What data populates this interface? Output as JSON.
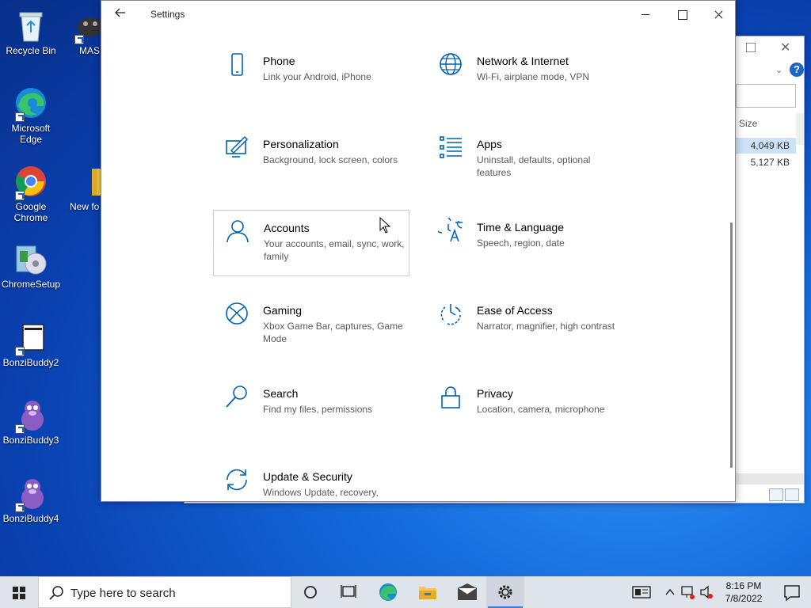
{
  "desktop": {
    "icons": [
      {
        "label": "Recycle Bin"
      },
      {
        "label": "MASM"
      },
      {
        "label": "Microsoft Edge"
      },
      {
        "label": "Google Chrome"
      },
      {
        "label": "New fo"
      },
      {
        "label": "ChromeSetup"
      },
      {
        "label": "BonziBuddy2"
      },
      {
        "label": "BonziBuddy3"
      },
      {
        "label": "BonziBuddy4"
      }
    ]
  },
  "explorer": {
    "column_header": "Size",
    "rows": [
      {
        "size": "4,049 KB",
        "selected": true
      },
      {
        "size": "5,127 KB",
        "selected": false
      }
    ]
  },
  "settings": {
    "title": "Settings",
    "tiles": [
      {
        "title": "Phone",
        "desc": "Link your Android, iPhone",
        "icon": "phone-icon"
      },
      {
        "title": "Network & Internet",
        "desc": "Wi-Fi, airplane mode, VPN",
        "icon": "globe-icon"
      },
      {
        "title": "Personalization",
        "desc": "Background, lock screen, colors",
        "icon": "paint-icon"
      },
      {
        "title": "Apps",
        "desc": "Uninstall, defaults, optional features",
        "icon": "apps-list-icon"
      },
      {
        "title": "Accounts",
        "desc": "Your accounts, email, sync, work, family",
        "icon": "person-icon"
      },
      {
        "title": "Time & Language",
        "desc": "Speech, region, date",
        "icon": "time-language-icon"
      },
      {
        "title": "Gaming",
        "desc": "Xbox Game Bar, captures, Game Mode",
        "icon": "xbox-icon"
      },
      {
        "title": "Ease of Access",
        "desc": "Narrator, magnifier, high contrast",
        "icon": "ease-of-access-icon"
      },
      {
        "title": "Search",
        "desc": "Find my files, permissions",
        "icon": "search-icon"
      },
      {
        "title": "Privacy",
        "desc": "Location, camera, microphone",
        "icon": "lock-icon"
      },
      {
        "title": "Update & Security",
        "desc": "Windows Update, recovery,",
        "icon": "update-icon"
      }
    ],
    "accent": "#0063b1"
  },
  "taskbar": {
    "search_placeholder": "Type here to search",
    "time": "8:16 PM",
    "date": "7/8/2022"
  }
}
